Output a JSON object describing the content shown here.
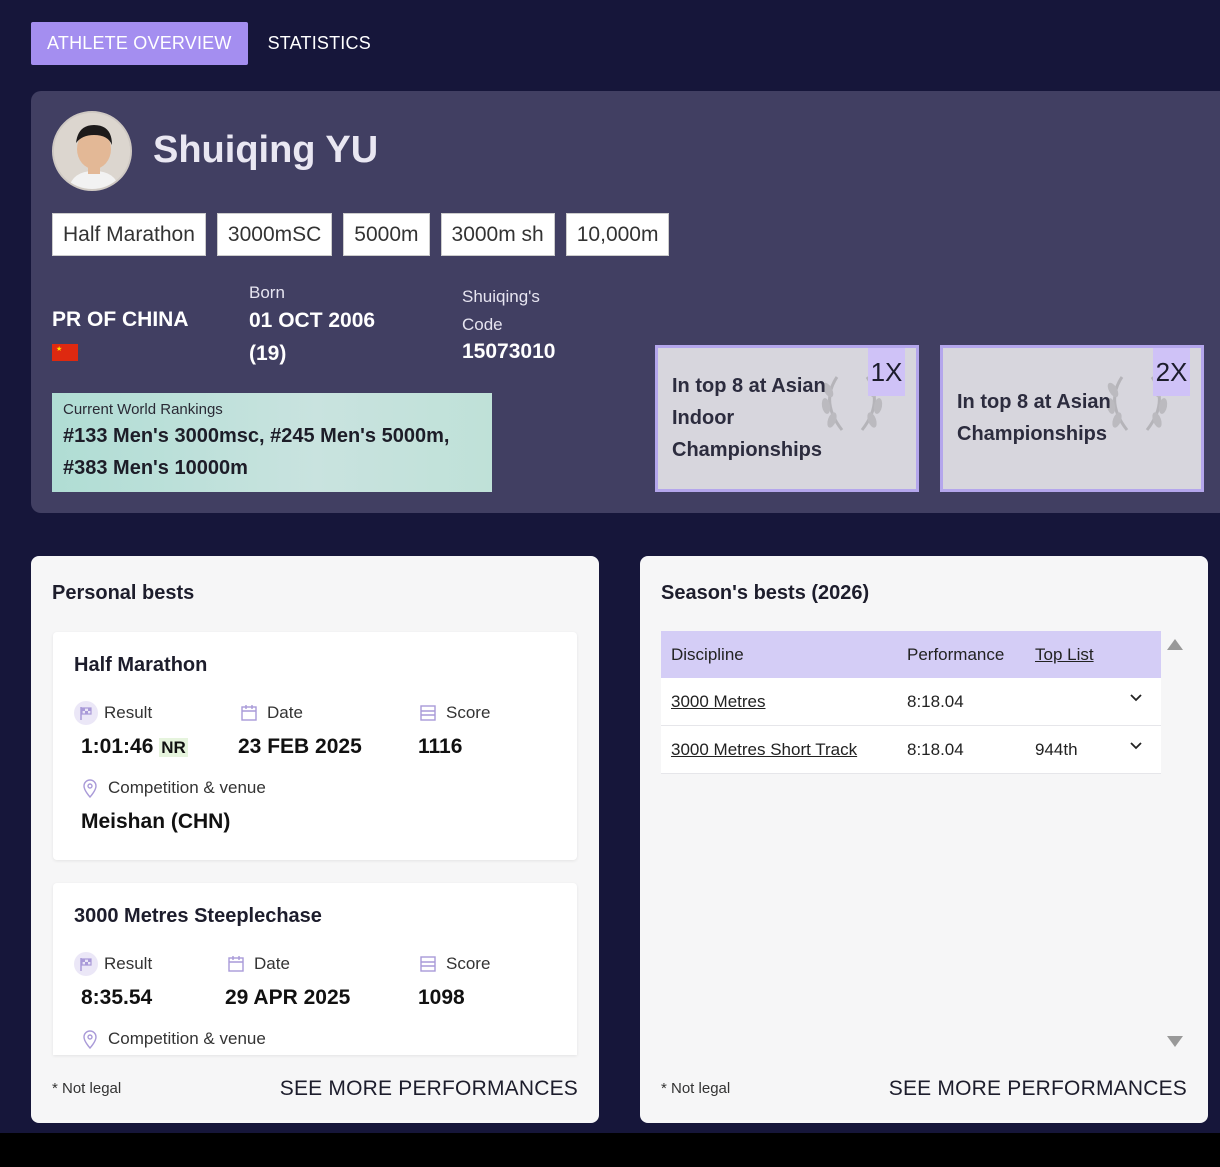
{
  "tabs": [
    {
      "label": "ATHLETE OVERVIEW",
      "active": true
    },
    {
      "label": "STATISTICS",
      "active": false
    }
  ],
  "athlete": {
    "name": "Shuiqing YU",
    "disciplines": [
      "Half Marathon",
      "3000mSC",
      "5000m",
      "3000m sh",
      "10,000m"
    ],
    "country": "PR OF CHINA",
    "born_label": "Born",
    "born_date": "01 OCT 2006",
    "age": "(19)",
    "code_label": "Shuiqing's Code",
    "code": "15073010",
    "rankings_label": "Current World Rankings",
    "rankings_text": "#133 Men's 3000msc, #245 Men's 5000m, #383 Men's 10000m"
  },
  "honours": [
    {
      "text": "In top 8 at Asian Indoor Championships",
      "count": "1X"
    },
    {
      "text": "In top 8 at Asian Championships",
      "count": "2X"
    }
  ],
  "personal_bests": {
    "title": "Personal bests",
    "items": [
      {
        "discipline": "Half Marathon",
        "result_label": "Result",
        "result": "1:01:46",
        "flag": "NR",
        "date_label": "Date",
        "date": "23 FEB 2025",
        "score_label": "Score",
        "score": "1116",
        "venue_label": "Competition & venue",
        "venue": "Meishan (CHN)"
      },
      {
        "discipline": "3000 Metres Steeplechase",
        "result_label": "Result",
        "result": "8:35.54",
        "flag": "",
        "date_label": "Date",
        "date": "29 APR 2025",
        "score_label": "Score",
        "score": "1098",
        "venue_label": "Competition & venue",
        "venue": ""
      }
    ],
    "footnote": "* Not legal",
    "see_more": "SEE MORE PERFORMANCES"
  },
  "season_bests": {
    "title": "Season's bests (2026)",
    "columns": [
      "Discipline",
      "Performance",
      "Top List"
    ],
    "rows": [
      {
        "discipline": "3000 Metres",
        "performance": "8:18.04",
        "top_list": ""
      },
      {
        "discipline": "3000 Metres Short Track",
        "performance": "8:18.04",
        "top_list": "944th"
      }
    ],
    "footnote": "* Not legal",
    "see_more": "SEE MORE PERFORMANCES"
  },
  "colors": {
    "background": "#16163a",
    "hero": "#413f62",
    "accent": "#a48ef0",
    "table_header": "#d4cdf6"
  }
}
